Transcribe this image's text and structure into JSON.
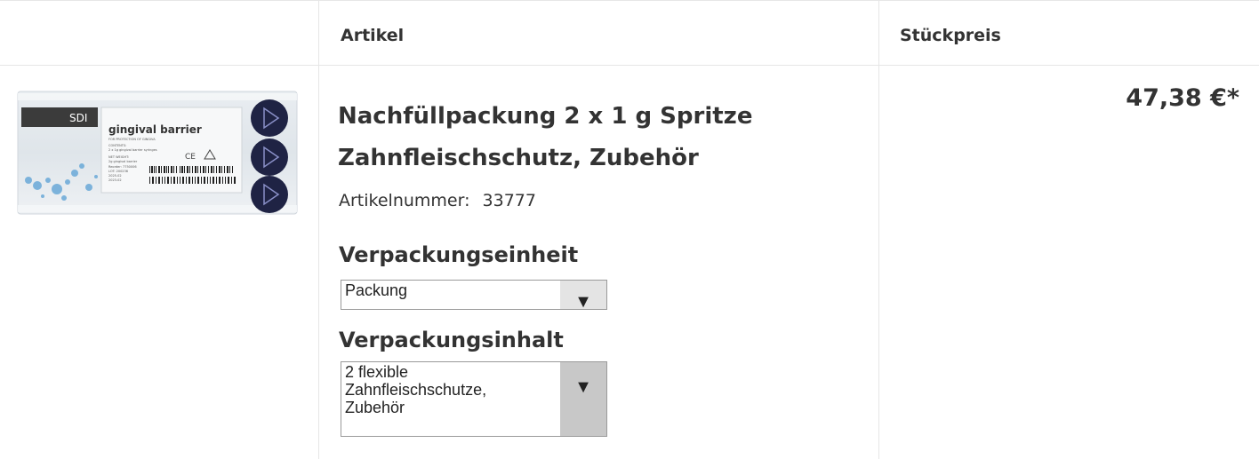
{
  "table": {
    "headers": {
      "article": "Artikel",
      "unit_price": "Stückpreis"
    }
  },
  "product": {
    "title_line1": "Nachfüllpackung 2 x 1 g Spritze",
    "title_line2": "Zahnfleischschutz, Zubehör",
    "article_number_label": "Artikelnummer:",
    "article_number": "33777",
    "price": "47,38 €*",
    "image": {
      "brand": "SDI",
      "name": "gingival barrier",
      "subtitle": "FOR PROTECTION OF GINGIVA",
      "contents_label": "CONTENTS:",
      "contents": "2 x 1g gingival barrier syringes",
      "net_weight_label": "NET WEIGHT:",
      "net_weight": "2g gingival barrier",
      "reorder": "Reorder: 7750006",
      "lot": "LOT: 200236",
      "exp": "2025-02",
      "mfg": "2023-02"
    },
    "packaging_unit": {
      "label": "Verpackungseinheit",
      "selected": "Packung"
    },
    "packaging_content": {
      "label": "Verpackungsinhalt",
      "selected_line1": "2 flexible",
      "selected_line2": "Zahnfleischschutze,",
      "selected_line3": "Zubehör"
    }
  },
  "icons": {
    "select_arrow": "▼"
  },
  "colors": {
    "border": "#e6e6e6",
    "text": "#333333",
    "select_arrow_bg": "#c8c8c8"
  }
}
